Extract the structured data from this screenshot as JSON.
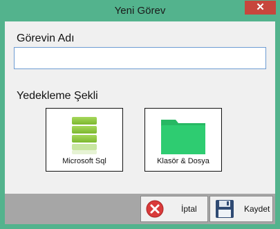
{
  "window": {
    "title": "Yeni Görev",
    "close_symbol": "✕"
  },
  "form": {
    "task_name_label": "Görevin Adı",
    "task_name_value": "",
    "backup_method_label": "Yedekleme Şekli"
  },
  "options": [
    {
      "label": "Microsoft Sql",
      "icon": "database-icon"
    },
    {
      "label": "Klasör & Dosya",
      "icon": "folder-icon"
    }
  ],
  "buttons": {
    "cancel": {
      "label": "İptal",
      "icon": "cancel-icon"
    },
    "save": {
      "label": "Kaydet",
      "icon": "floppy-disk-icon"
    }
  },
  "colors": {
    "window_border": "#53b38d",
    "close_button": "#c7463c",
    "footer": "#a6a6a6",
    "database_icon": "#8cc63e",
    "folder_icon": "#2ecc71",
    "cancel_icon": "#d93a3a"
  }
}
